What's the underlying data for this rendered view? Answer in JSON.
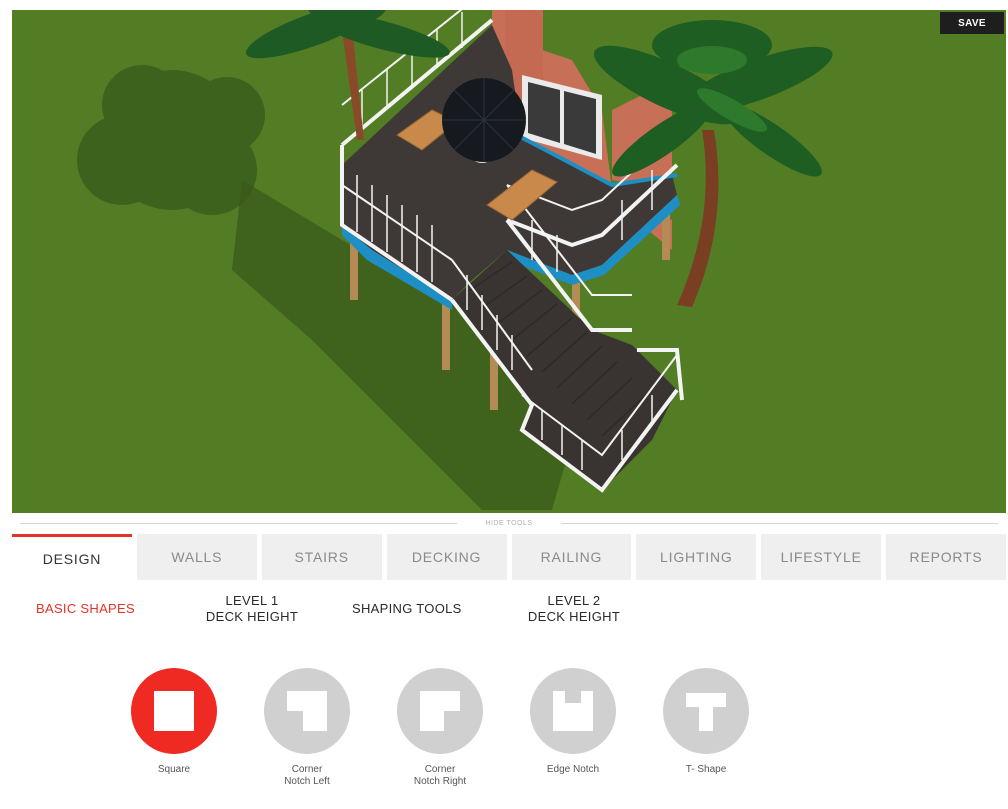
{
  "viewport": {
    "save_label": "SAVE",
    "ground_color": "#4f7a22",
    "deck_color": "#3e3936",
    "rail_color": "#f3f3f3",
    "wall_color": "#c86f58"
  },
  "hide_tools_label": "HIDE TOOLS",
  "tabs": [
    {
      "label": "DESIGN",
      "active": true
    },
    {
      "label": "WALLS"
    },
    {
      "label": "STAIRS"
    },
    {
      "label": "DECKING"
    },
    {
      "label": "RAILING"
    },
    {
      "label": "LIGHTING"
    },
    {
      "label": "LIFESTYLE"
    },
    {
      "label": "REPORTS"
    }
  ],
  "subtabs": [
    {
      "label": "BASIC SHAPES",
      "active": true
    },
    {
      "line1": "LEVEL 1",
      "line2": "DECK HEIGHT"
    },
    {
      "label": "SHAPING TOOLS"
    },
    {
      "line1": "LEVEL 2",
      "line2": "DECK HEIGHT"
    }
  ],
  "shapes": [
    {
      "line1": "Square",
      "line2": "",
      "icon": "square-shape-icon",
      "active": true
    },
    {
      "line1": "Corner",
      "line2": "Notch Left",
      "icon": "corner-notch-left-icon"
    },
    {
      "line1": "Corner",
      "line2": "Notch Right",
      "icon": "corner-notch-right-icon"
    },
    {
      "line1": "Edge Notch",
      "line2": "",
      "icon": "edge-notch-icon"
    },
    {
      "line1": "T- Shape",
      "line2": "",
      "icon": "t-shape-icon"
    }
  ],
  "colors": {
    "accent": "#e53227",
    "shape_active": "#ee2a22",
    "shape_inactive": "#d0d0d0"
  }
}
